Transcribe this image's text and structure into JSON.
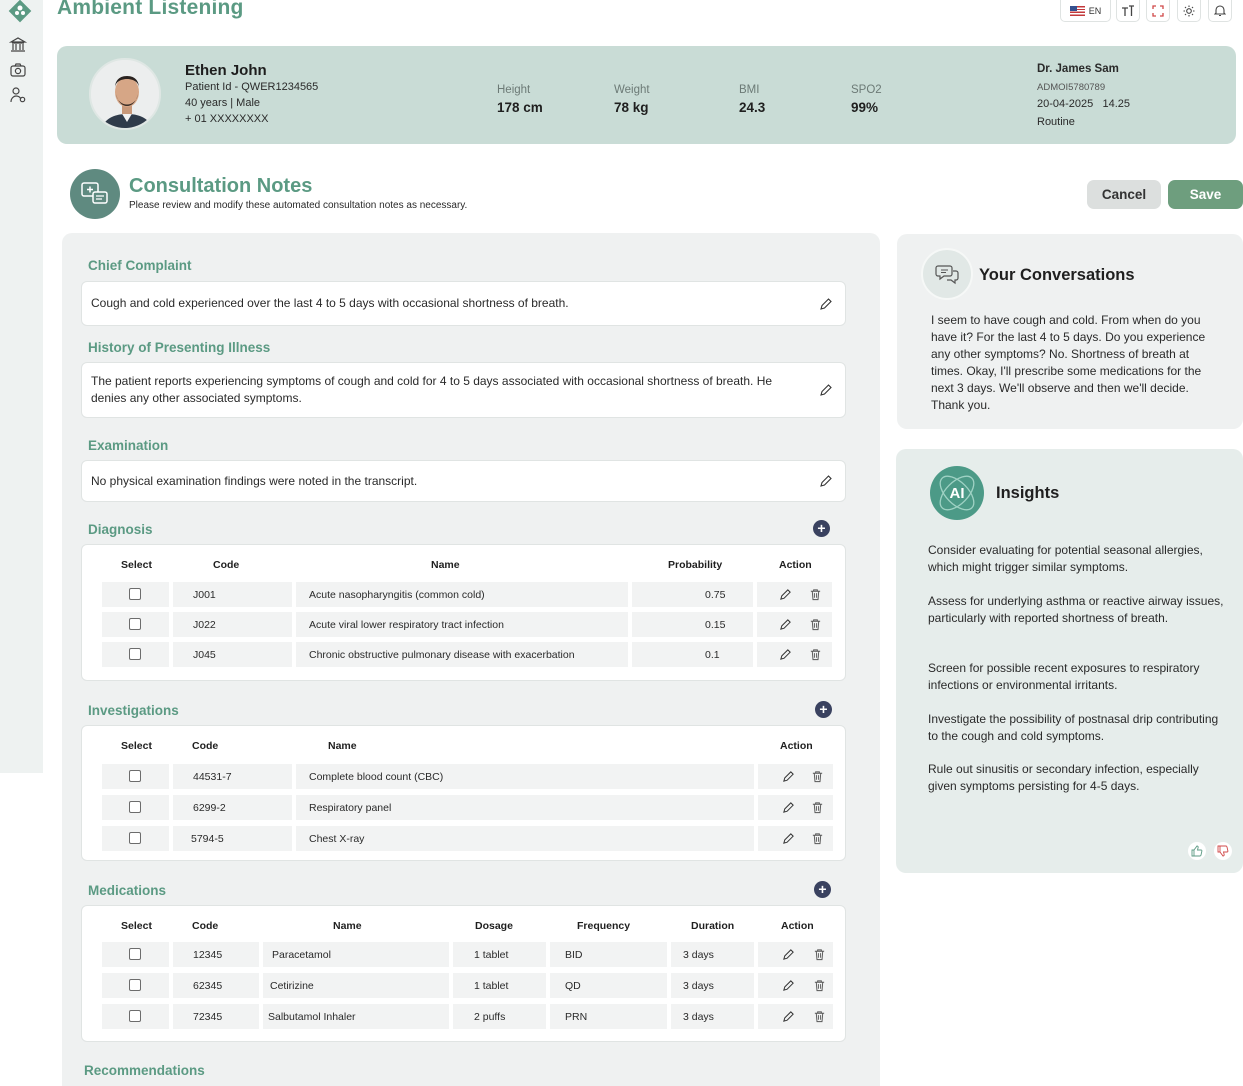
{
  "app": {
    "title": "Ambient Listening"
  },
  "toolbar": {
    "language": "EN"
  },
  "patient": {
    "name": "Ethen John",
    "patient_id": "Patient Id - QWER1234565",
    "age_sex": "40 years | Male",
    "phone": "+ 01 XXXXXXXX",
    "vitals": [
      {
        "label": "Height",
        "value": "178 cm"
      },
      {
        "label": "Weight",
        "value": "78 kg"
      },
      {
        "label": "BMI",
        "value": "24.3"
      },
      {
        "label": "SPO2",
        "value": "99%"
      }
    ],
    "doctor": "Dr. James Sam",
    "admission_id": "ADMOI5780789",
    "date": "20-04-2025",
    "time": "14.25",
    "visit_type": "Routine"
  },
  "consultation": {
    "title": "Consultation Notes",
    "subtitle": "Please review and modify these automated consultation notes as necessary.",
    "cancel_label": "Cancel",
    "save_label": "Save"
  },
  "chief_complaint": {
    "title": "Chief Complaint",
    "text": "Cough and cold experienced over the last 4 to 5 days with occasional shortness of breath."
  },
  "history": {
    "title": "History of Presenting Illness",
    "text": "The patient reports experiencing symptoms of cough and cold for 4 to 5 days associated with occasional shortness of breath. He denies any other associated symptoms."
  },
  "examination": {
    "title": "Examination",
    "text": "No physical examination findings were noted in the transcript."
  },
  "diagnosis": {
    "title": "Diagnosis",
    "headers": {
      "select": "Select",
      "code": "Code",
      "name": "Name",
      "probability": "Probability",
      "action": "Action"
    },
    "rows": [
      {
        "code": "J001",
        "name": "Acute nasopharyngitis (common cold)",
        "probability": "0.75"
      },
      {
        "code": "J022",
        "name": "Acute viral lower respiratory tract infection",
        "probability": "0.15"
      },
      {
        "code": "J045",
        "name": "Chronic obstructive pulmonary disease with exacerbation",
        "probability": "0.1"
      }
    ]
  },
  "investigations": {
    "title": "Investigations",
    "headers": {
      "select": "Select",
      "code": "Code",
      "name": "Name",
      "action": "Action"
    },
    "rows": [
      {
        "code": "44531-7",
        "name": "Complete blood count (CBC)"
      },
      {
        "code": "6299-2",
        "name": "Respiratory panel"
      },
      {
        "code": "5794-5",
        "name": "Chest X-ray"
      }
    ]
  },
  "medications": {
    "title": "Medications",
    "headers": {
      "select": "Select",
      "code": "Code",
      "name": "Name",
      "dosage": "Dosage",
      "frequency": "Frequency",
      "duration": "Duration",
      "action": "Action"
    },
    "rows": [
      {
        "code": "12345",
        "name": "Paracetamol",
        "dosage": "1 tablet",
        "frequency": "BID",
        "duration": "3 days"
      },
      {
        "code": "62345",
        "name": "Cetirizine",
        "dosage": "1 tablet",
        "frequency": "QD",
        "duration": "3 days"
      },
      {
        "code": "72345",
        "name": "Salbutamol Inhaler",
        "dosage": "2 puffs",
        "frequency": "PRN",
        "duration": "3 days"
      }
    ]
  },
  "recommendations": {
    "title": "Recommendations"
  },
  "conversations": {
    "title": "Your Conversations",
    "text": "I seem to have cough and cold. From when do you have it? For the last 4 to 5 days. Do you experience any other symptoms? No. Shortness of breath at times. Okay, I'll prescribe some medications for the next 3 days. We'll observe and then we'll decide. Thank you."
  },
  "insights": {
    "title": "Insights",
    "icon_text": "AI",
    "items": [
      "Consider evaluating for potential seasonal allergies, which might trigger similar symptoms.",
      "Assess for underlying asthma or reactive airway issues, particularly with reported shortness of breath.",
      "Screen for possible recent exposures to respiratory infections or environmental irritants.",
      "Investigate the possibility of postnasal drip contributing to the cough and cold symptoms.",
      "Rule out sinusitis or secondary infection, especially given symptoms persisting for 4-5 days."
    ]
  },
  "colors": {
    "accent": "#5b9a83",
    "banner": "#c9dcd6",
    "save": "#6e9e7e",
    "plus": "#3a4260"
  }
}
